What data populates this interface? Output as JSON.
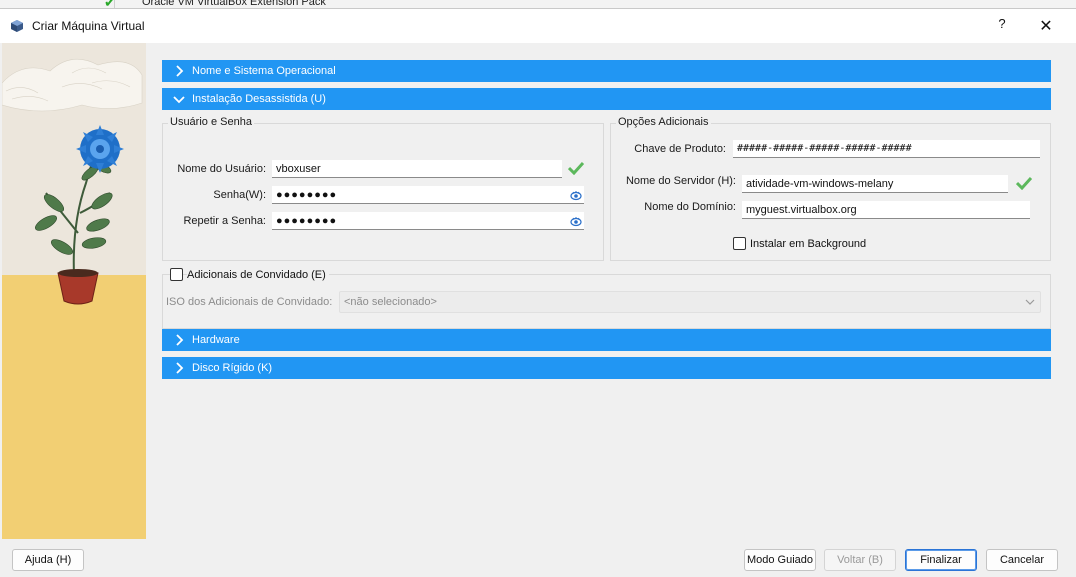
{
  "background_window": {
    "item_label": "Oracle VM VirtualBox Extension Pack"
  },
  "dialog": {
    "title": "Criar Máquina Virtual",
    "help_label": "?",
    "close_label": "✕"
  },
  "sections": {
    "name_os": "Nome e Sistema Operacional",
    "unattended": "Instalação Desassistida (U)",
    "hardware": "Hardware",
    "disk": "Disco Rígido (K)"
  },
  "user_password": {
    "group_title": "Usuário e Senha",
    "username_label": "Nome do Usuário:",
    "username_value": "vboxuser",
    "password_label": "Senha(W):",
    "password_value": "●●●●●●●●",
    "repeat_label": "Repetir a Senha:",
    "repeat_value": "●●●●●●●●"
  },
  "additional_options": {
    "group_title": "Opções Adicionais",
    "product_key_label": "Chave de Produto:",
    "product_key_value": "#####-#####-#####-#####-#####",
    "hostname_label": "Nome do Servidor (H):",
    "hostname_value": "atividade-vm-windows-melany",
    "domain_label": "Nome do Domínio:",
    "domain_value": "myguest.virtualbox.org",
    "install_background_label": "Instalar em Background",
    "install_background_checked": false
  },
  "guest_additions": {
    "checkbox_label": "Adicionais de Convidado (E)",
    "checked": false,
    "iso_label": "ISO dos Adicionais de Convidado:",
    "iso_value": "<não selecionado>"
  },
  "buttons": {
    "help": "Ajuda (H)",
    "guided_mode": "Modo Guiado",
    "back": "Voltar (B)",
    "finish": "Finalizar",
    "cancel": "Cancelar"
  },
  "colors": {
    "section_header": "#2196f3",
    "valid_check": "#5cb85c",
    "side_sky": "#e8e2d8",
    "side_floor": "#f2cf73"
  }
}
